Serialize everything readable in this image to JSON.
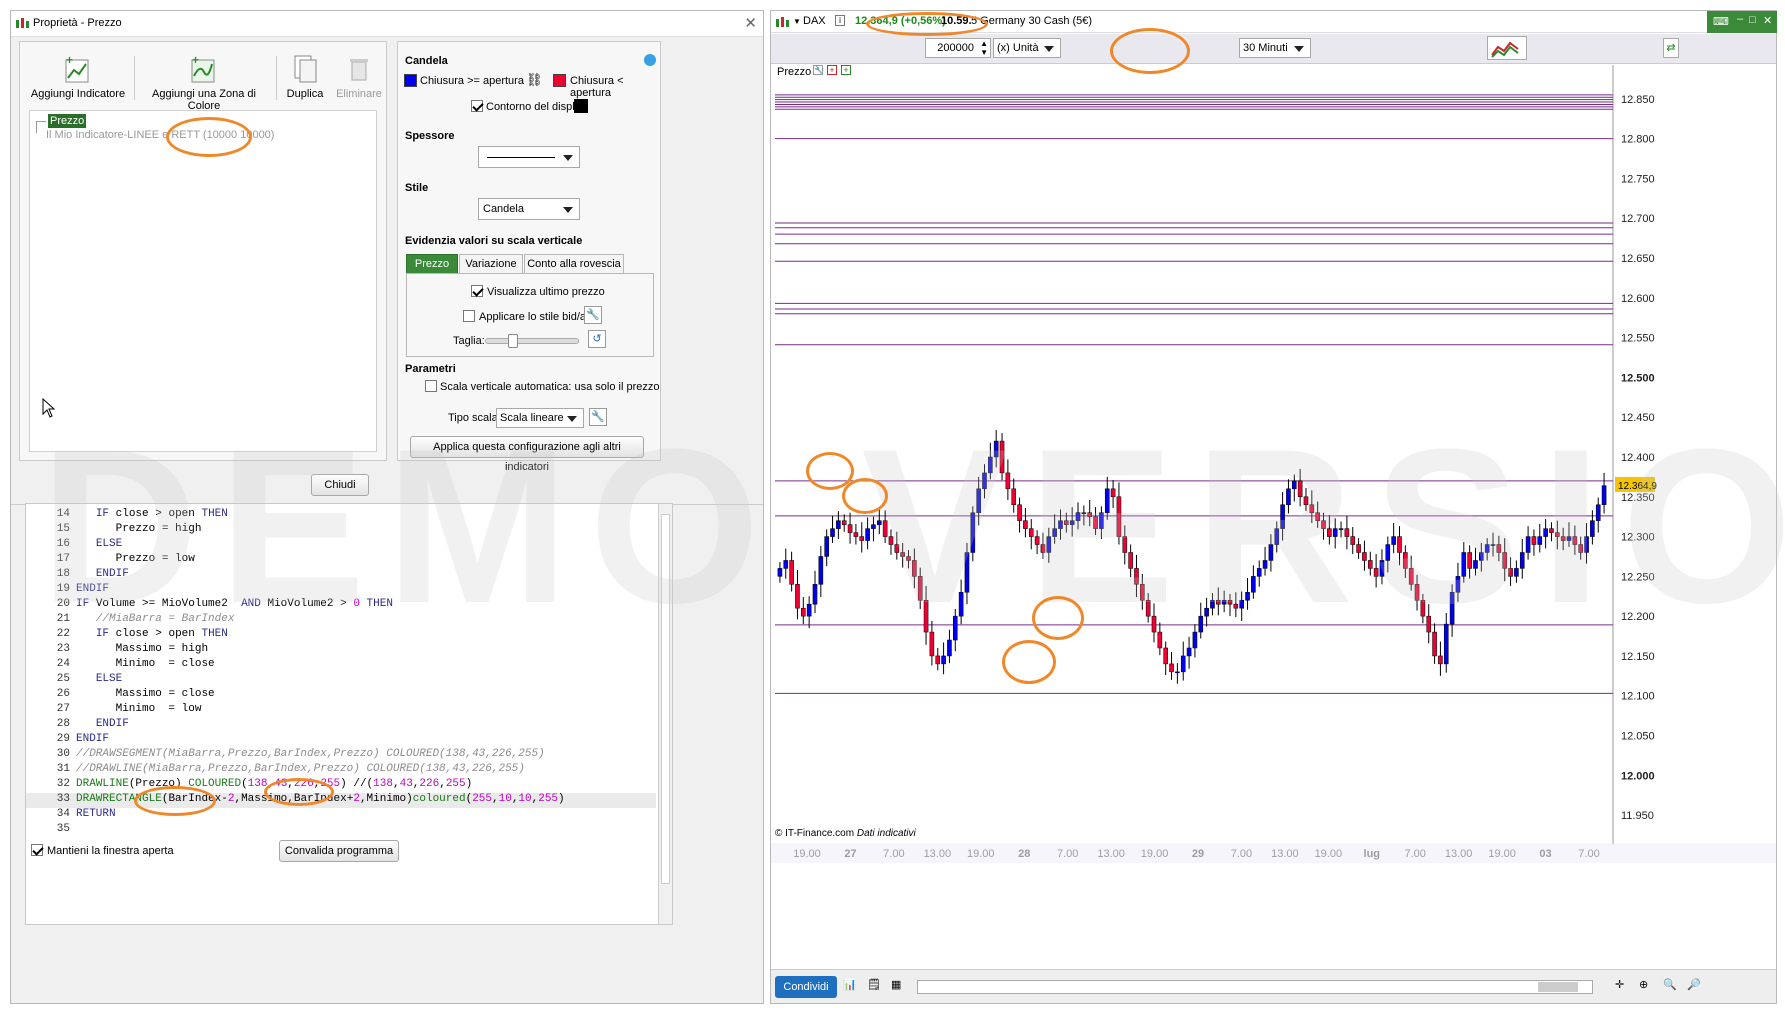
{
  "left_window": {
    "title": "Proprietà - Prezzo",
    "toolbar": {
      "add_indicator": "Aggiungi Indicatore",
      "add_color_zone": "Aggiungi una Zona di Colore",
      "duplicate": "Duplica",
      "delete": "Eliminare"
    },
    "tree": {
      "selected": "Prezzo",
      "child": "Il Mio Indicatore-LINEE e RETT (10000 10000)"
    },
    "close_button": "Chiudi",
    "keep_open": "Mantieni la finestra aperta",
    "validate": "Convalida programma"
  },
  "props": {
    "candle_header": "Candela",
    "close_up": "Chiusura >= apertura",
    "close_down": "Chiusura < apertura",
    "outline": "Contorno del display",
    "thickness_header": "Spessore",
    "style_header": "Stile",
    "style_value": "Candela",
    "highlight_header": "Evidenzia valori su scala verticale",
    "tabs": [
      "Prezzo",
      "Variazione",
      "Conto alla rovescia"
    ],
    "show_last_price": "Visualizza ultimo prezzo",
    "apply_bid_ask": "Applicare lo stile bid/ask",
    "size_label": "Taglia:",
    "params_header": "Parametri",
    "auto_scale": "Scala verticale automatica: usa solo il prezzo",
    "scale_type_label": "Tipo scala",
    "scale_type_value": "Scala lineare",
    "apply_all": "Applica questa configurazione agli altri indicatori",
    "up_color": "#0000ee",
    "down_color": "#ee0033"
  },
  "code_lines": [
    {
      "n": "14",
      "html": "   IF close > open THEN"
    },
    {
      "n": "15",
      "html": "      Prezzo = high"
    },
    {
      "n": "16",
      "html": "   ELSE"
    },
    {
      "n": "17",
      "html": "      Prezzo = low"
    },
    {
      "n": "18",
      "html": "   ENDIF"
    },
    {
      "n": "19",
      "html": "ENDIF"
    },
    {
      "n": "20",
      "html": "IF Volume >= MioVolume2  AND MioVolume2 > 0 THEN"
    },
    {
      "n": "21",
      "html": "   //MiaBarra = BarIndex"
    },
    {
      "n": "22",
      "html": "   IF close > open THEN"
    },
    {
      "n": "23",
      "html": "      Massimo = high"
    },
    {
      "n": "24",
      "html": "      Minimo  = close"
    },
    {
      "n": "25",
      "html": "   ELSE"
    },
    {
      "n": "26",
      "html": "      Massimo = close"
    },
    {
      "n": "27",
      "html": "      Minimo  = low"
    },
    {
      "n": "28",
      "html": "   ENDIF"
    },
    {
      "n": "29",
      "html": "ENDIF"
    },
    {
      "n": "30",
      "html": "//DRAWSEGMENT(MiaBarra,Prezzo,BarIndex,Prezzo) COLOURED(138,43,226,255)"
    },
    {
      "n": "31",
      "html": "//DRAWLINE(MiaBarra,Prezzo,BarIndex,Prezzo) COLOURED(138,43,226,255)"
    },
    {
      "n": "32",
      "html": "DRAWLINE(Prezzo) COLOURED(138,43,226,255) //(138,43,226,255)"
    },
    {
      "n": "33",
      "html": "DRAWRECTANGLE(BarIndex-2,Massimo,BarIndex+2,Minimo)coloured(255,10,10,255)"
    },
    {
      "n": "34",
      "html": "RETURN"
    },
    {
      "n": "35",
      "html": ""
    }
  ],
  "chart_window": {
    "symbol": "DAX",
    "last_price": "12.364,9 (+0,56%)",
    "time": "10.59.",
    "instrument": "5 Germany 30 Cash (5€)",
    "quantity": "200000",
    "unit": "(x) Unità",
    "timeframe": "30 Minuti",
    "pane_label": "Prezzo",
    "source": "© IT-Finance.com",
    "source_note": "Dati indicativi",
    "price_tag": "12.364,9",
    "share_button": "Condividi",
    "watermark": "DEMO VERSION"
  },
  "chart_data": {
    "type": "candlestick",
    "title": "",
    "y_ticks": [
      "12.850",
      "12.800",
      "12.750",
      "12.700",
      "12.650",
      "12.600",
      "12.550",
      "12.500",
      "12.450",
      "12.400",
      "12.350",
      "12.300",
      "12.250",
      "12.200",
      "12.150",
      "12.100",
      "12.050",
      "12.000",
      "11.950"
    ],
    "y_bold_ticks": [
      "12.500",
      "12.000"
    ],
    "x_labels": [
      "19.00",
      "27",
      "7.00",
      "13.00",
      "19.00",
      "28",
      "7.00",
      "13.00",
      "19.00",
      "29",
      "7.00",
      "13.00",
      "19.00",
      "lug",
      "7.00",
      "13.00",
      "19.00",
      "03",
      "7.00"
    ],
    "x_bold_labels": [
      "27",
      "28",
      "29",
      "lug",
      "03"
    ],
    "ylim": [
      11925,
      12880
    ],
    "horizontal_levels": [
      12855,
      12852,
      12849,
      12846,
      12843,
      12840,
      12837,
      12800,
      12694,
      12688,
      12680,
      12668,
      12646,
      12593,
      12586,
      12580,
      12541,
      12370,
      12326,
      12189,
      12103
    ],
    "level_color": "#7a2a8a",
    "last_price": 12364.9,
    "candles_close_path": [
      12260,
      12270,
      12240,
      12210,
      12200,
      12215,
      12240,
      12275,
      12300,
      12310,
      12320,
      12315,
      12305,
      12300,
      12295,
      12310,
      12315,
      12320,
      12300,
      12290,
      12280,
      12275,
      12270,
      12250,
      12220,
      12180,
      12150,
      12140,
      12150,
      12170,
      12200,
      12230,
      12280,
      12330,
      12360,
      12380,
      12400,
      12420,
      12380,
      12360,
      12340,
      12320,
      12310,
      12300,
      12290,
      12280,
      12300,
      12310,
      12320,
      12315,
      12320,
      12330,
      12330,
      12325,
      12310,
      12330,
      12360,
      12350,
      12300,
      12280,
      12260,
      12240,
      12220,
      12200,
      12180,
      12160,
      12140,
      12130,
      12130,
      12150,
      12160,
      12180,
      12200,
      12210,
      12220,
      12215,
      12220,
      12215,
      12210,
      12220,
      12230,
      12250,
      12260,
      12270,
      12290,
      12310,
      12340,
      12360,
      12370,
      12350,
      12340,
      12330,
      12320,
      12310,
      12300,
      12310,
      12310,
      12300,
      12290,
      12280,
      12270,
      12260,
      12250,
      12270,
      12290,
      12300,
      12280,
      12260,
      12240,
      12220,
      12200,
      12180,
      12150,
      12140,
      12190,
      12230,
      12250,
      12280,
      12260,
      12270,
      12280,
      12290,
      12290,
      12280,
      12260,
      12250,
      12260,
      12280,
      12300,
      12290,
      12300,
      12310,
      12305,
      12300,
      12295,
      12300,
      12290,
      12280,
      12300,
      12320,
      12340,
      12364
    ]
  }
}
